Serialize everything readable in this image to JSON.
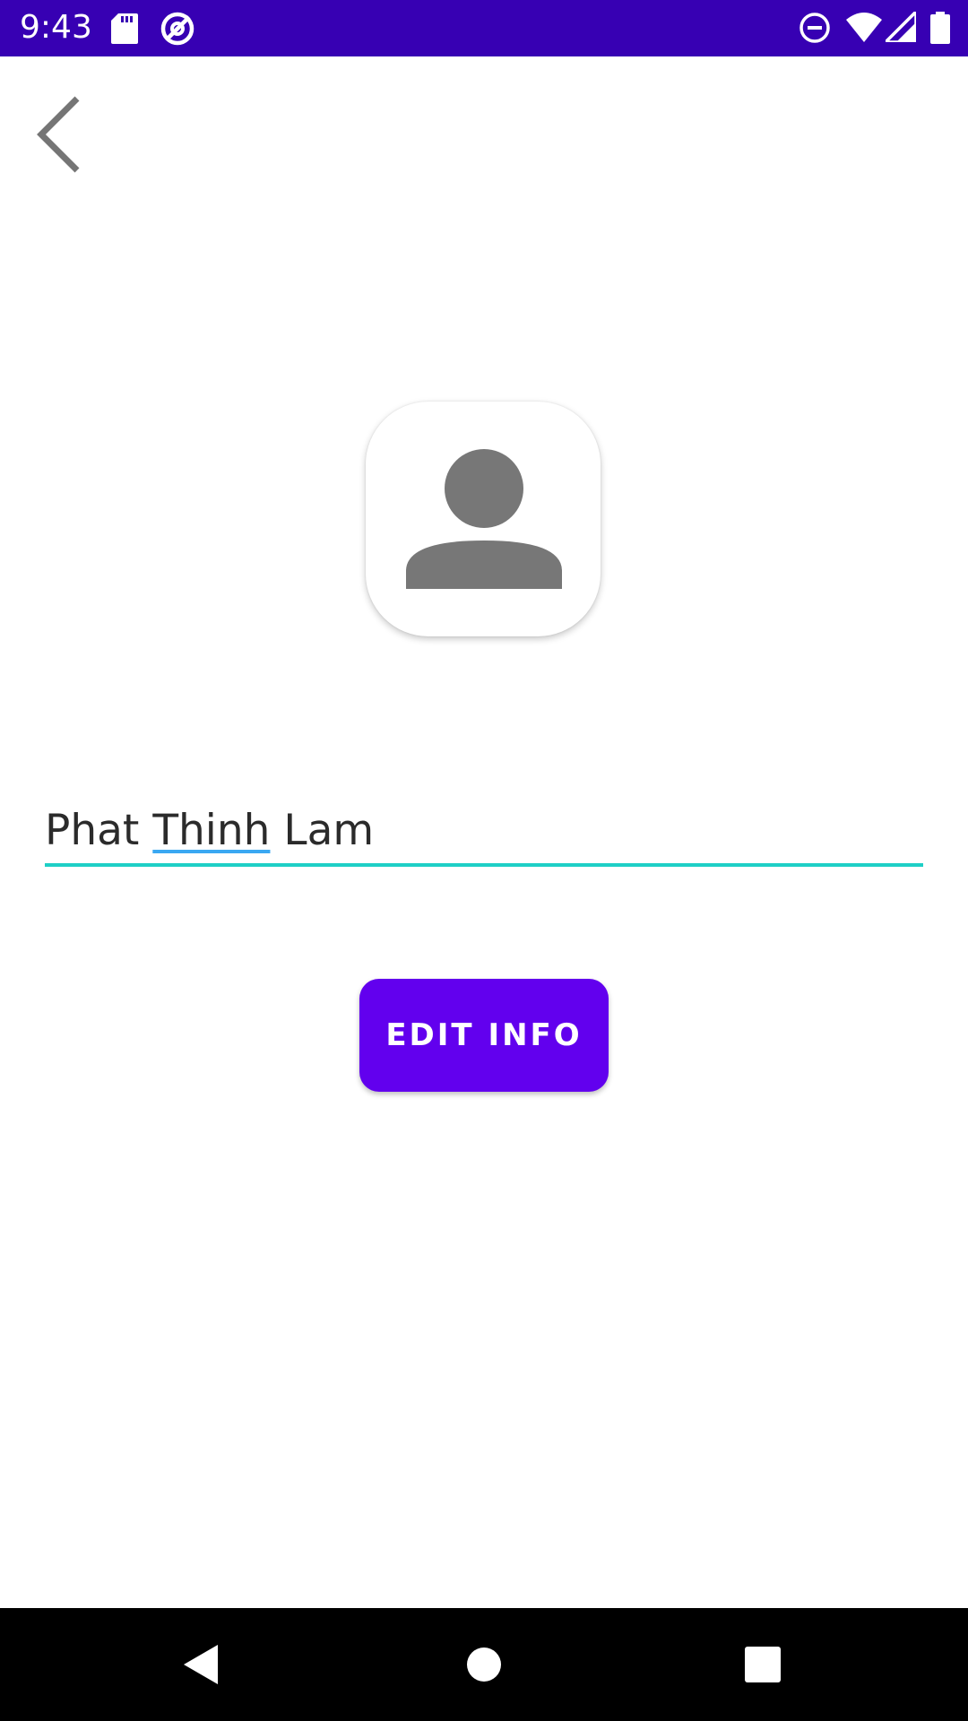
{
  "status_bar": {
    "time": "9:43",
    "background_color": "#3700b3",
    "left_icons": [
      "sd-card-icon",
      "vpn-icon"
    ],
    "right_icons": [
      "do-not-disturb-icon",
      "wifi-icon",
      "signal-icon",
      "battery-icon"
    ]
  },
  "toolbar": {
    "back_icon": "chevron-left-icon"
  },
  "profile": {
    "avatar_icon": "person-icon",
    "name_parts": [
      "Phat ",
      "Thinh",
      " Lam"
    ],
    "field_underline_color": "#1ecfc6",
    "spellcheck_underline_color": "#3aa8f2"
  },
  "actions": {
    "edit_label": "EDIT INFO",
    "button_color": "#6200ee"
  },
  "nav_bar": {
    "back_icon": "nav-back-icon",
    "home_icon": "nav-home-icon",
    "recents_icon": "nav-recents-icon"
  }
}
